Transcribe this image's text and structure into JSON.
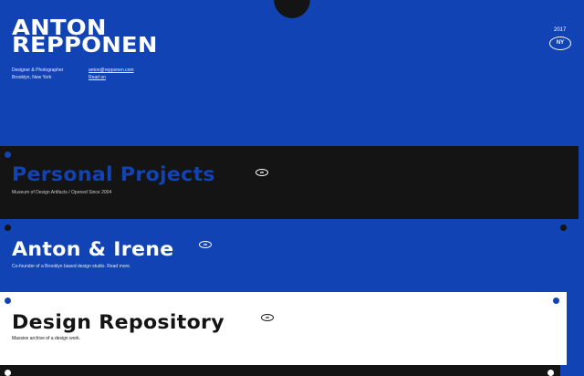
{
  "header": {
    "name_line1": "ANTON",
    "name_line2": "REPPONEN",
    "role": "Designer & Photographer",
    "location": "Brooklyn, New York",
    "email": "anton@repponen.com",
    "read_link": "Read on",
    "year": "2017",
    "city_badge": "NY"
  },
  "projects": [
    {
      "title": "Personal Projects",
      "subtitle": "Museum of Design Artifacts / Opened Since 2004",
      "tag": "ab"
    },
    {
      "title": "Anton & Irene",
      "subtitle": "Co-founder of a Brooklyn based design studio. Read more.",
      "tag": "ab"
    },
    {
      "title": "Design Repository",
      "subtitle": "Massive archive of a design work.",
      "tag": "ab"
    }
  ],
  "colors": {
    "primary_blue": "#1243b5",
    "dark": "#141414",
    "white": "#ffffff"
  }
}
